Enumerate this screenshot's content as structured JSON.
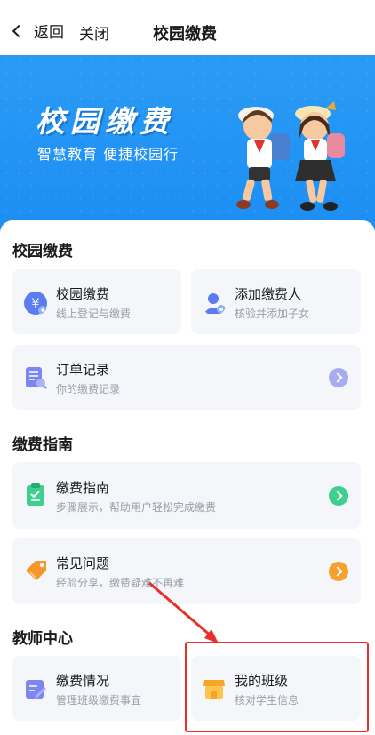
{
  "nav": {
    "back_label": "返回",
    "close_label": "关闭",
    "title": "校园缴费"
  },
  "banner": {
    "headline": "校园缴费",
    "tagline": "智慧教育 便捷校园行"
  },
  "sections": {
    "payment": {
      "title": "校园缴费",
      "items": [
        {
          "name": "校园缴费",
          "desc": "线上登记与缴费",
          "icon": "yuan-coin-icon",
          "color": "#5b7cf0"
        },
        {
          "name": "添加缴费人",
          "desc": "核验并添加子女",
          "icon": "add-person-icon",
          "color": "#5b7cf0"
        },
        {
          "name": "订单记录",
          "desc": "你的缴费记录",
          "icon": "order-list-icon",
          "color": "#7b86ee"
        }
      ]
    },
    "guide": {
      "title": "缴费指南",
      "items": [
        {
          "name": "缴费指南",
          "desc": "步骤展示，帮助用户轻松完成缴费",
          "icon": "clipboard-icon",
          "color": "#3ccf8e"
        },
        {
          "name": "常见问题",
          "desc": "经验分享，缴费疑难不再难",
          "icon": "tag-icon",
          "color": "#f5962a"
        }
      ]
    },
    "teacher": {
      "title": "教师中心",
      "items": [
        {
          "name": "缴费情况",
          "desc": "管理班级缴费事宜",
          "icon": "edit-doc-icon",
          "color": "#7b86ee"
        },
        {
          "name": "我的班级",
          "desc": "核对学生信息",
          "icon": "store-icon",
          "color": "#f5a623"
        }
      ]
    }
  },
  "colors": {
    "banner_blue": "#1c8ef3",
    "annotation_red": "#e8302a"
  }
}
